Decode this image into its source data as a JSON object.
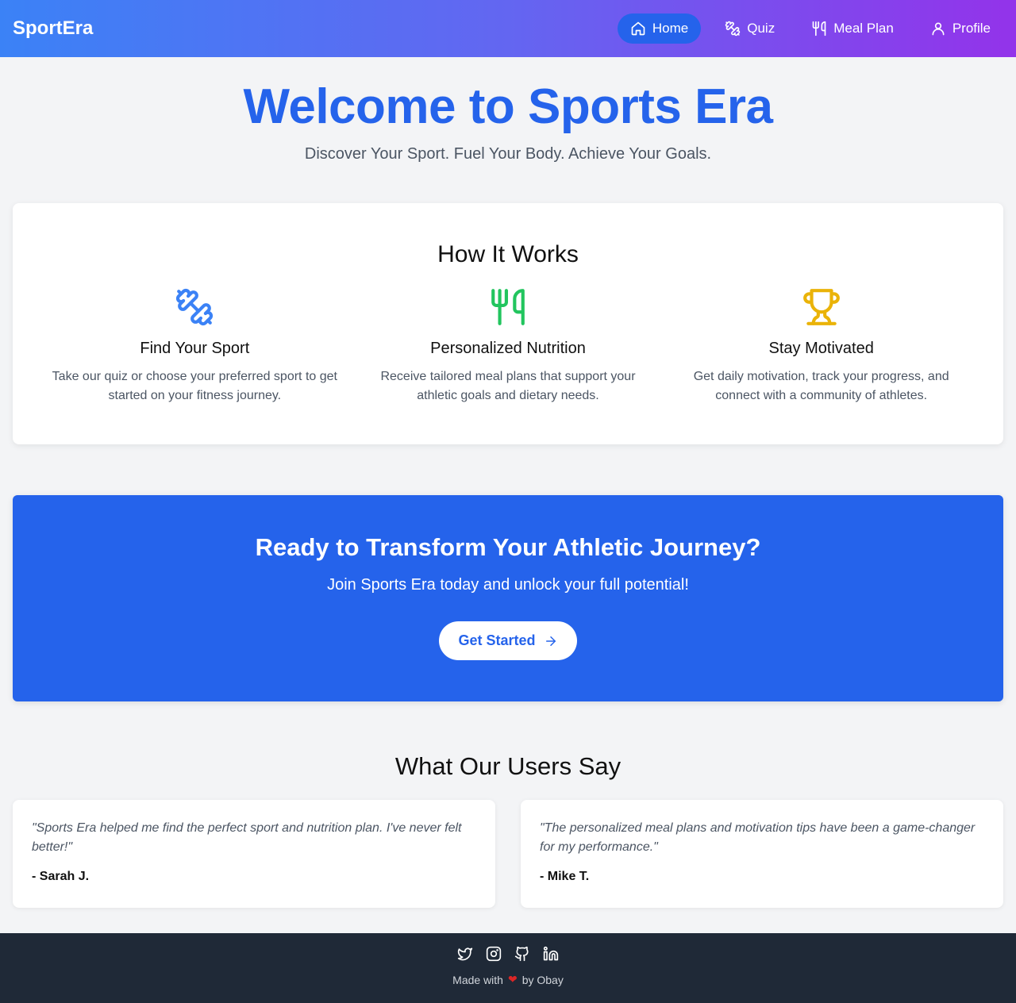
{
  "navbar": {
    "brand": "SportEra",
    "items": [
      {
        "label": "Home",
        "icon": "home-icon",
        "active": true
      },
      {
        "label": "Quiz",
        "icon": "dumbbell-icon"
      },
      {
        "label": "Meal Plan",
        "icon": "utensils-icon"
      },
      {
        "label": "Profile",
        "icon": "user-icon"
      }
    ]
  },
  "hero": {
    "title": "Welcome to Sports Era",
    "subtitle": "Discover Your Sport. Fuel Your Body. Achieve Your Goals."
  },
  "how_it_works": {
    "title": "How It Works",
    "features": [
      {
        "icon": "dumbbell-icon",
        "color": "#3b82f6",
        "title": "Find Your Sport",
        "text": "Take our quiz or choose your preferred sport to get started on your fitness journey."
      },
      {
        "icon": "utensils-icon",
        "color": "#22c55e",
        "title": "Personalized Nutrition",
        "text": "Receive tailored meal plans that support your athletic goals and dietary needs."
      },
      {
        "icon": "trophy-icon",
        "color": "#eab308",
        "title": "Stay Motivated",
        "text": "Get daily motivation, track your progress, and connect with a community of athletes."
      }
    ]
  },
  "cta": {
    "title": "Ready to Transform Your Athletic Journey?",
    "text": "Join Sports Era today and unlock your full potential!",
    "button_label": "Get Started"
  },
  "testimonials": {
    "title": "What Our Users Say",
    "items": [
      {
        "quote": "\"Sports Era helped me find the perfect sport and nutrition plan. I've never felt better!\"",
        "author": "- Sarah J."
      },
      {
        "quote": "\"The personalized meal plans and motivation tips have been a game-changer for my performance.\"",
        "author": "- Mike T."
      }
    ]
  },
  "footer": {
    "socials": [
      "twitter-icon",
      "instagram-icon",
      "github-icon",
      "linkedin-icon"
    ],
    "made_with": "Made with",
    "by": "by Obay"
  },
  "colors": {
    "primary": "#2563eb",
    "nav_gradient_start": "#3b82f6",
    "nav_gradient_end": "#9333ea",
    "footer_bg": "#1f2937"
  }
}
